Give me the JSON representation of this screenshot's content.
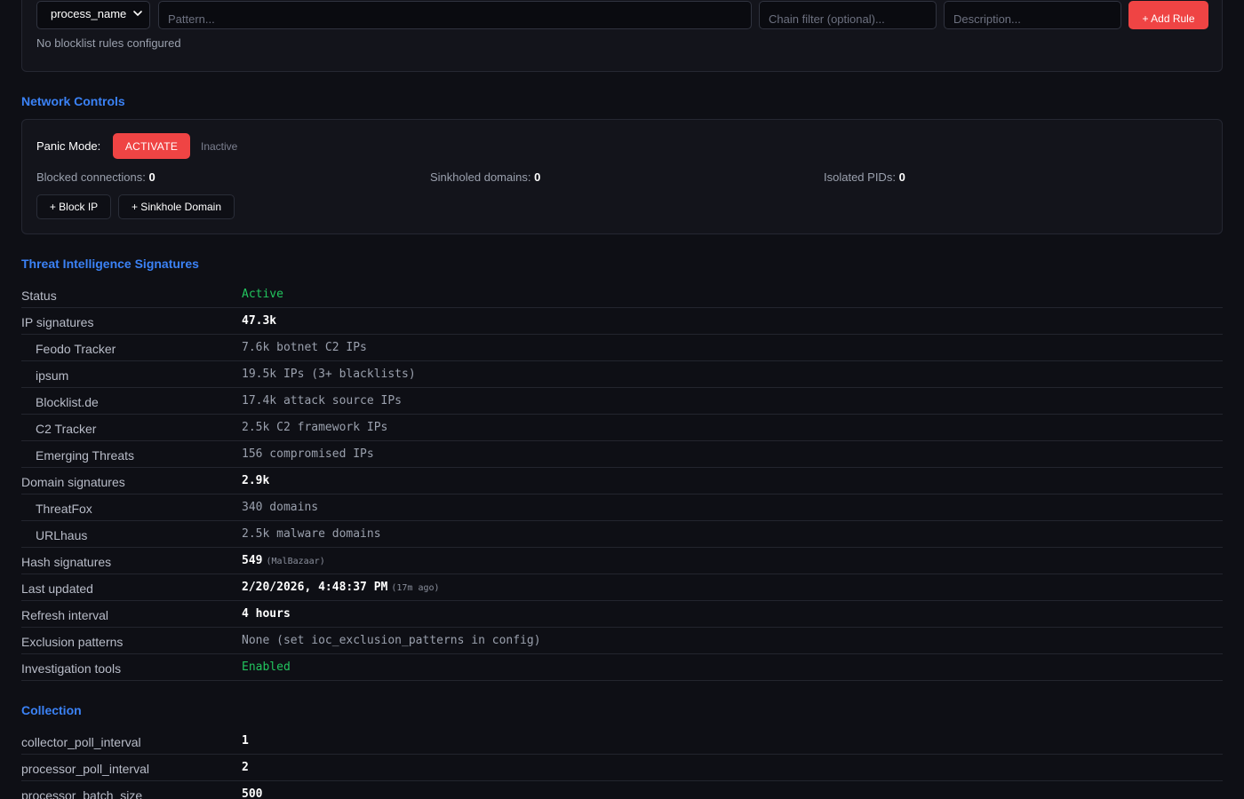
{
  "blocklist": {
    "field_select_value": "process_name",
    "pattern_placeholder": "Pattern...",
    "chain_placeholder": "Chain filter (optional)...",
    "description_placeholder": "Description...",
    "add_rule_label": "+ Add Rule",
    "empty_note": "No blocklist rules configured"
  },
  "network": {
    "title": "Network Controls",
    "panic_label": "Panic Mode:",
    "activate_label": "ACTIVATE",
    "panic_status": "Inactive",
    "blocked_label": "Blocked connections:",
    "blocked_value": "0",
    "sinkholed_label": "Sinkholed domains:",
    "sinkholed_value": "0",
    "isolated_label": "Isolated PIDs:",
    "isolated_value": "0",
    "block_ip_label": "+ Block IP",
    "sinkhole_label": "+ Sinkhole Domain"
  },
  "threat": {
    "title": "Threat Intelligence Signatures",
    "rows": [
      {
        "key": "Status",
        "value": "Active",
        "note": ""
      },
      {
        "key": "IP signatures",
        "value": "47.3k",
        "note": ""
      },
      {
        "key": "Feodo Tracker",
        "value": "7.6k botnet C2 IPs",
        "note": ""
      },
      {
        "key": "ipsum",
        "value": "19.5k IPs (3+ blacklists)",
        "note": ""
      },
      {
        "key": "Blocklist.de",
        "value": "17.4k attack source IPs",
        "note": ""
      },
      {
        "key": "C2 Tracker",
        "value": "2.5k C2 framework IPs",
        "note": ""
      },
      {
        "key": "Emerging Threats",
        "value": "156 compromised IPs",
        "note": ""
      },
      {
        "key": "Domain signatures",
        "value": "2.9k",
        "note": ""
      },
      {
        "key": "ThreatFox",
        "value": "340 domains",
        "note": ""
      },
      {
        "key": "URLhaus",
        "value": "2.5k malware domains",
        "note": ""
      },
      {
        "key": "Hash signatures",
        "value": "549",
        "note": "(MalBazaar)"
      },
      {
        "key": "Last updated",
        "value": "2/20/2026, 4:48:37 PM",
        "note": "(17m ago)"
      },
      {
        "key": "Refresh interval",
        "value": "4 hours",
        "note": ""
      },
      {
        "key": "Exclusion patterns",
        "value": "None (set ioc_exclusion_patterns in config)",
        "note": ""
      },
      {
        "key": "Investigation tools",
        "value": "Enabled",
        "note": ""
      }
    ]
  },
  "collection": {
    "title": "Collection",
    "rows": [
      {
        "key": "collector_poll_interval",
        "value": "1"
      },
      {
        "key": "processor_poll_interval",
        "value": "2"
      },
      {
        "key": "processor_batch_size",
        "value": "500"
      }
    ]
  },
  "colors": {
    "accent": "#3b82f6",
    "danger": "#ef4444",
    "success": "#22c55e"
  }
}
